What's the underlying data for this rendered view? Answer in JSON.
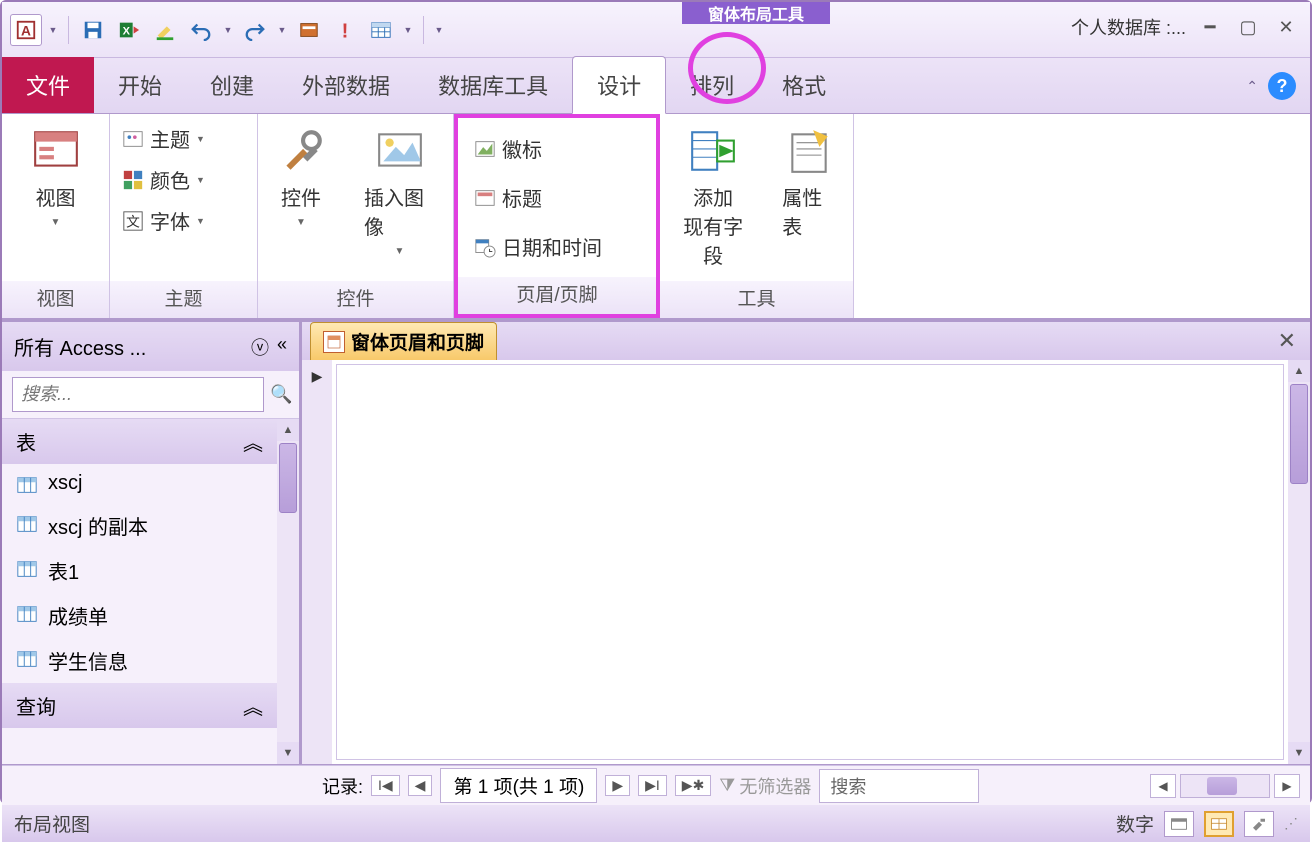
{
  "title_tool_tab": "窗体布局工具",
  "title_db": "个人数据库 :...",
  "ribbon": {
    "tabs": {
      "file": "文件",
      "home": "开始",
      "create": "创建",
      "external": "外部数据",
      "dbtools": "数据库工具",
      "design": "设计",
      "arrange": "排列",
      "format": "格式"
    },
    "groups": {
      "view": {
        "label": "视图",
        "btn": "视图"
      },
      "theme": {
        "label": "主题",
        "theme": "主题",
        "color": "颜色",
        "font": "字体"
      },
      "controls": {
        "label": "控件",
        "controls": "控件",
        "insert_image": "插入图像"
      },
      "headerfooter": {
        "label": "页眉/页脚",
        "logo": "徽标",
        "title": "标题",
        "datetime": "日期和时间"
      },
      "tools": {
        "label": "工具",
        "addfield": "添加\n现有字段",
        "propsheet": "属性表"
      }
    }
  },
  "nav": {
    "header": "所有 Access ...",
    "search_placeholder": "搜索...",
    "cat_tables": "表",
    "cat_queries": "查询",
    "items": [
      "xscj",
      "xscj 的副本",
      "表1",
      "成绩单",
      "学生信息"
    ]
  },
  "work": {
    "tab_title": "窗体页眉和页脚"
  },
  "recordnav": {
    "label": "记录:",
    "counter": "第 1 项(共 1 项)",
    "nofilter": "无筛选器",
    "search": "搜索"
  },
  "status": {
    "left": "布局视图",
    "numlock": "数字"
  }
}
